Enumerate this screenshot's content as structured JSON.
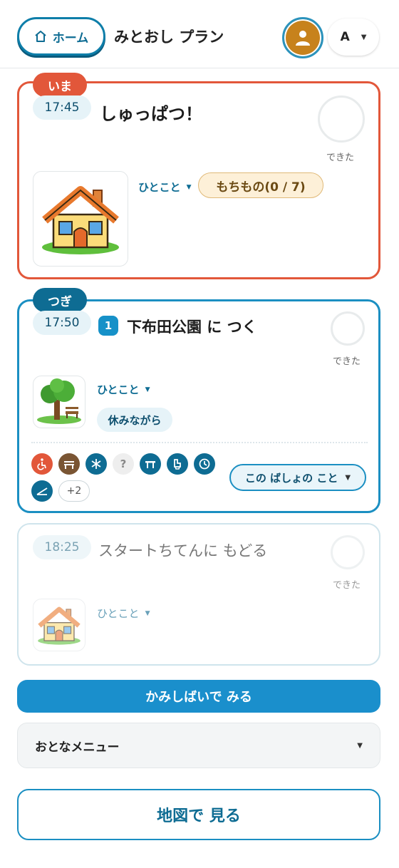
{
  "header": {
    "home_label": "ホーム",
    "plan_title": "みとおし プラン",
    "lang_label": "A"
  },
  "colors": {
    "now_accent": "#e2573a",
    "next_accent": "#1b8fc2",
    "primary_dark": "#0e6c93",
    "avatar_bg": "#c7821c"
  },
  "steps": [
    {
      "tag": "いま",
      "time": "17:45",
      "title": "しゅっぱつ！",
      "done_label": "できた",
      "image_icon": "house-icon",
      "hitokoto_label": "ひとこと",
      "mochimono_label": "もちもの(0 / 7)"
    },
    {
      "tag": "つぎ",
      "time": "17:50",
      "step_number": "1",
      "title": "下布田公園 に つく",
      "done_label": "できた",
      "image_icon": "park-tree-icon",
      "hitokoto_label": "ひとこと",
      "note": "休みながら",
      "facilities": [
        {
          "icon": "wheelchair-icon",
          "color": "#e2573a"
        },
        {
          "icon": "bench-icon",
          "color": "#7a5533"
        },
        {
          "icon": "snowflake-icon",
          "color": "#0e6c93"
        },
        {
          "icon": "question-icon",
          "color": "#eeeeee",
          "label": "?"
        },
        {
          "icon": "table-icon",
          "color": "#0e6c93"
        },
        {
          "icon": "toilet-icon",
          "color": "#0e6c93"
        },
        {
          "icon": "clock-icon",
          "color": "#0e6c93"
        },
        {
          "icon": "slope-icon",
          "color": "#0e6c93"
        }
      ],
      "facility_more": "+2",
      "place_button_label": "この ばしょの こと"
    },
    {
      "time": "18:25",
      "title": "スタートちてんに もどる",
      "done_label": "できた",
      "image_icon": "house-icon",
      "hitokoto_label": "ひとこと"
    }
  ],
  "kamishibai_label": "かみしばいで みる",
  "adult_menu_label": "おとなメニュー",
  "map_button_label": "地図で 見る"
}
